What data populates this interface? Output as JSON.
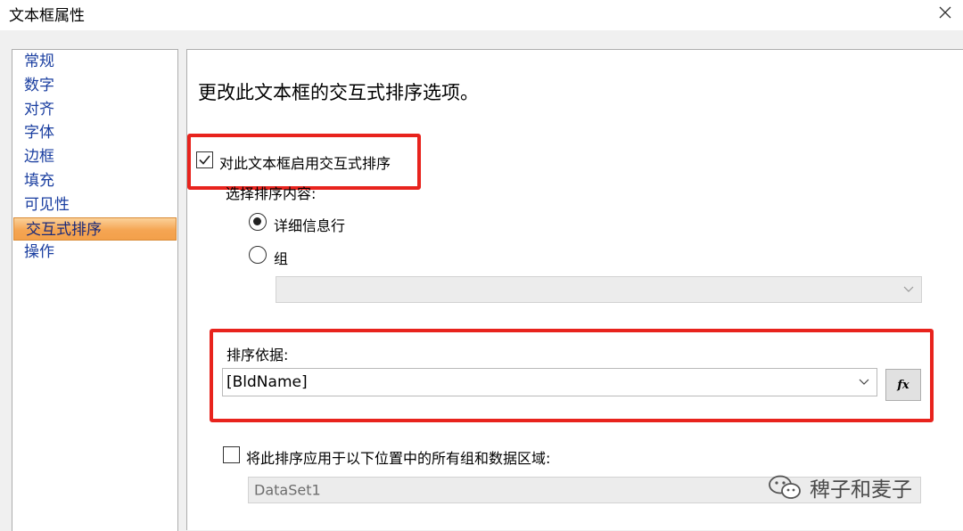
{
  "window": {
    "title": "文本框属性"
  },
  "sidebar": {
    "items": [
      {
        "label": "常规"
      },
      {
        "label": "数字"
      },
      {
        "label": "对齐"
      },
      {
        "label": "字体"
      },
      {
        "label": "边框"
      },
      {
        "label": "填充"
      },
      {
        "label": "可见性"
      },
      {
        "label": "交互式排序",
        "selected": true
      },
      {
        "label": "操作"
      }
    ]
  },
  "main": {
    "heading": "更改此文本框的交互式排序选项。",
    "enable_sort": {
      "label": "对此文本框启用交互式排序",
      "checked": true
    },
    "sort_scope": {
      "label": "选择排序内容:",
      "options": [
        {
          "label": "详细信息行",
          "selected": true
        },
        {
          "label": "组",
          "selected": false
        }
      ],
      "group_select_value": ""
    },
    "sort_by": {
      "label": "排序依据:",
      "value": "[BldName]",
      "expression_button": "fx"
    },
    "apply_all": {
      "label": "将此排序应用于以下位置中的所有组和数据区域:",
      "checked": false,
      "dataset_value": "DataSet1"
    }
  },
  "watermark": {
    "text": "稗子和麦子"
  },
  "colors": {
    "highlight_box": "#e8231d",
    "nav_text": "#1a3ea0",
    "nav_selected": "#f5a553"
  }
}
